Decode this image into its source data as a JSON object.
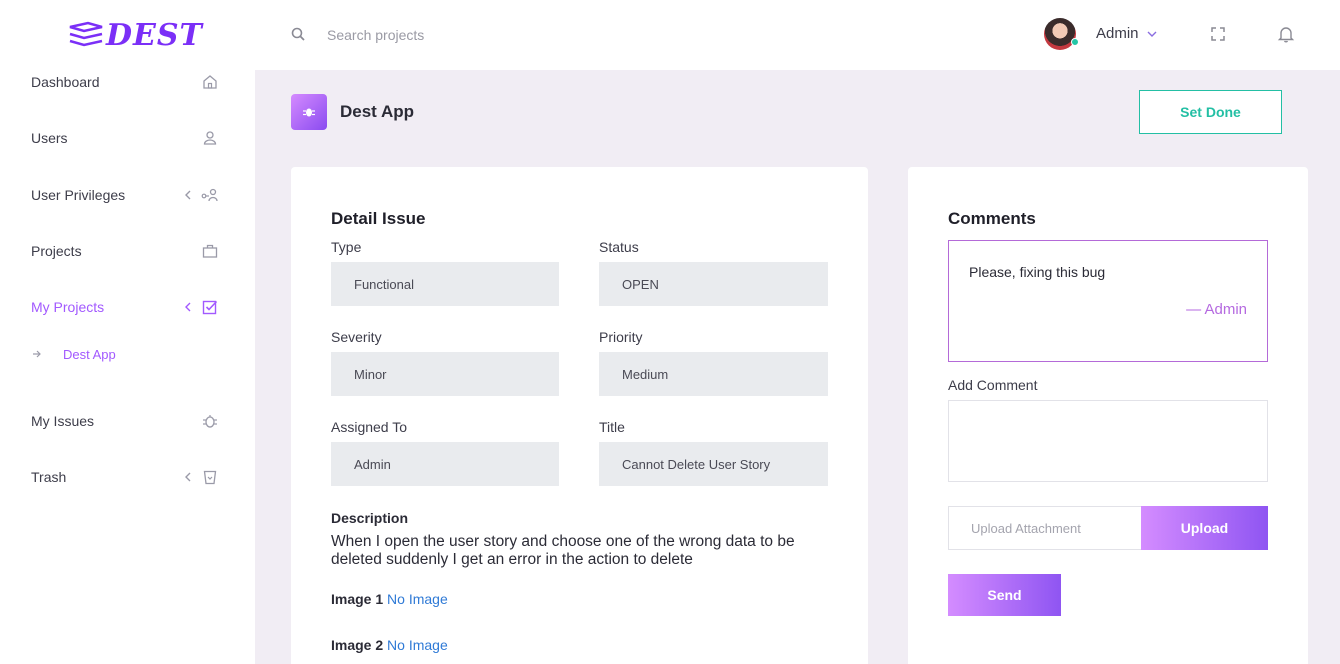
{
  "brand": {
    "logo_text": "DEST",
    "accent_color": "#a259ff",
    "teal_color": "#23bfa4"
  },
  "header": {
    "search_placeholder": "Search projects",
    "user_name": "Admin"
  },
  "sidebar": {
    "items": [
      {
        "label": "Dashboard",
        "icon": "home-icon"
      },
      {
        "label": "Users",
        "icon": "user-icon"
      },
      {
        "label": "User Privileges",
        "icon": "user-key-icon"
      },
      {
        "label": "Projects",
        "icon": "briefcase-icon"
      },
      {
        "label": "My Projects",
        "icon": "checklist-icon"
      },
      {
        "label": "My Issues",
        "icon": "bug-icon"
      },
      {
        "label": "Trash",
        "icon": "trash-icon"
      }
    ],
    "sub_items": [
      {
        "label": "Dest App"
      }
    ]
  },
  "page": {
    "project_title": "Dest App",
    "set_done_label": "Set Done"
  },
  "detail": {
    "title": "Detail Issue",
    "fields": {
      "type": {
        "label": "Type",
        "value": "Functional"
      },
      "status": {
        "label": "Status",
        "value": "OPEN"
      },
      "severity": {
        "label": "Severity",
        "value": "Minor"
      },
      "priority": {
        "label": "Priority",
        "value": "Medium"
      },
      "assigned_to": {
        "label": "Assigned To",
        "value": "Admin"
      },
      "title": {
        "label": "Title",
        "value": "Cannot Delete User Story"
      }
    },
    "description_label": "Description",
    "description": "When I open the user story and choose one of the wrong data to be deleted suddenly I get an error in the action to delete",
    "images": [
      {
        "label": "Image 1",
        "value": "No Image"
      },
      {
        "label": "Image 2",
        "value": "No Image"
      }
    ]
  },
  "comments": {
    "title": "Comments",
    "entries": [
      {
        "text": "Please, fixing this bug",
        "author": "— Admin"
      }
    ],
    "add_label": "Add Comment",
    "upload_placeholder": "Upload Attachment",
    "upload_label": "Upload",
    "send_label": "Send"
  }
}
